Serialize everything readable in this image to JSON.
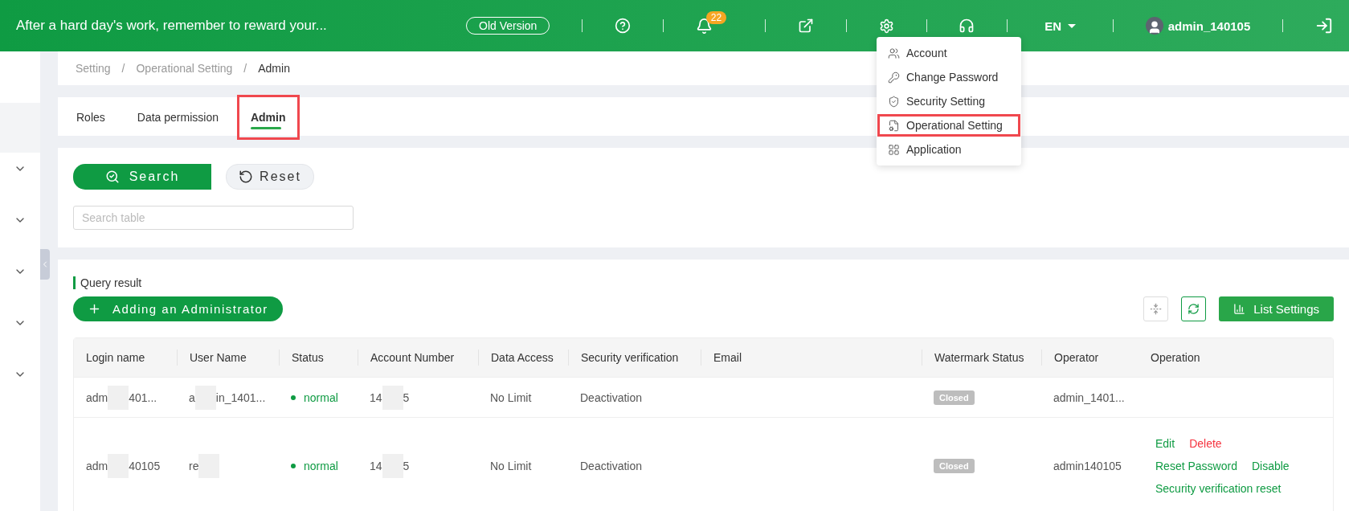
{
  "header": {
    "slogan": "After a hard day's work, remember to reward your...",
    "old_version": "Old Version",
    "notifications": "22",
    "language": "EN",
    "username": "admin_140105"
  },
  "settings_menu": {
    "items": [
      {
        "label": "Account",
        "annotated": false
      },
      {
        "label": "Change Password",
        "annotated": false
      },
      {
        "label": "Security Setting",
        "annotated": false
      },
      {
        "label": "Operational Setting",
        "annotated": true
      },
      {
        "label": "Application",
        "annotated": false
      }
    ]
  },
  "sidebar": {
    "items": [
      {
        "kind": "block"
      },
      {
        "kind": "chevron"
      },
      {
        "kind": "chevron"
      },
      {
        "kind": "chevron"
      },
      {
        "kind": "chevron"
      },
      {
        "kind": "chevron"
      }
    ]
  },
  "breadcrumb": {
    "separators": [
      "/",
      "/"
    ],
    "items": [
      "Setting",
      "Operational Setting",
      "Admin"
    ]
  },
  "tabs": [
    {
      "label": "Roles",
      "selected": false,
      "annotated": false
    },
    {
      "label": "Data permission",
      "selected": false,
      "annotated": false
    },
    {
      "label": "Admin",
      "selected": true,
      "annotated": true
    }
  ],
  "search": {
    "search_button": "Search",
    "reset_button": "Reset",
    "placeholder": "Search table"
  },
  "results": {
    "title": "Query result",
    "add_button": "Adding an Administrator",
    "list_settings": "List Settings",
    "table": {
      "columns": [
        "Login name",
        "User Name",
        "Status",
        "Account Number",
        "Data Access",
        "Security verification",
        "Email",
        "Watermark Status",
        "Operator",
        "Operation"
      ],
      "rows": [
        {
          "login_name": [
            "adm",
            "401..."
          ],
          "user_name": [
            "a",
            "in_1401..."
          ],
          "status": "normal",
          "account_number": [
            "14",
            "5"
          ],
          "data_access": "No Limit",
          "security_verification": "Deactivation",
          "watermark_status": "Closed",
          "operator": "admin_1401...",
          "operations": []
        },
        {
          "login_name": [
            "adm",
            "40105"
          ],
          "user_name": [
            "re"
          ],
          "status": "normal",
          "account_number": [
            "14",
            "5"
          ],
          "data_access": "No Limit",
          "security_verification": "Deactivation",
          "watermark_status": "Closed",
          "operator": "admin140105",
          "operations": [
            [
              {
                "label": "Edit",
                "danger": false
              },
              {
                "label": "Delete",
                "danger": true
              }
            ],
            [
              {
                "label": "Reset Password",
                "danger": false
              },
              {
                "label": "Disable",
                "danger": false
              }
            ],
            [
              {
                "label": "Security verification reset",
                "danger": false
              }
            ]
          ]
        }
      ]
    }
  }
}
